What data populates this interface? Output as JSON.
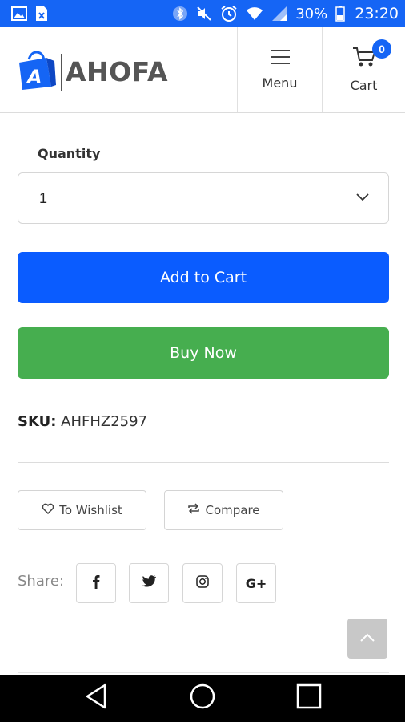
{
  "status_bar": {
    "battery": "30%",
    "time": "23:20"
  },
  "header": {
    "logo_text": "AHOFA",
    "logo_mark": "A",
    "menu_label": "Menu",
    "cart_label": "Cart",
    "cart_count": "0"
  },
  "product": {
    "quantity_label": "Quantity",
    "quantity_value": "1",
    "add_to_cart_label": "Add to Cart",
    "buy_now_label": "Buy Now",
    "sku_label": "SKU:",
    "sku_value": "AHFHZ2597",
    "wishlist_label": "To Wishlist",
    "compare_label": "Compare",
    "share_label": "Share:"
  },
  "colors": {
    "brand_blue": "#0a5cff",
    "buy_green": "#46ae4f",
    "status_bar": "#1565f5"
  }
}
